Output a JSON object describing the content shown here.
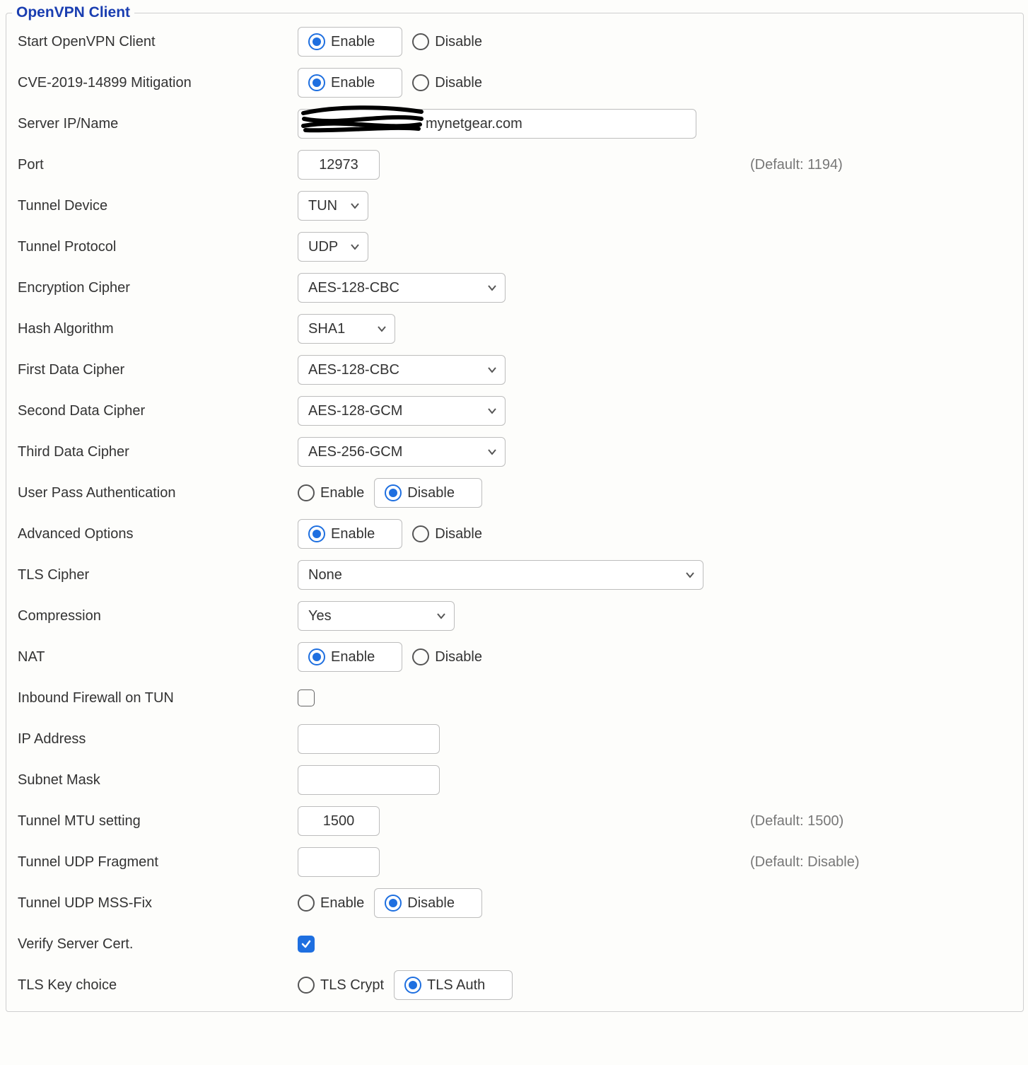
{
  "legend": "OpenVPN Client",
  "labels": {
    "start": "Start OpenVPN Client",
    "cve": "CVE-2019-14899 Mitigation",
    "server": "Server IP/Name",
    "port": "Port",
    "tundev": "Tunnel Device",
    "tunproto": "Tunnel Protocol",
    "encCipher": "Encryption Cipher",
    "hash": "Hash Algorithm",
    "dc1": "First Data Cipher",
    "dc2": "Second Data Cipher",
    "dc3": "Third Data Cipher",
    "upa": "User Pass Authentication",
    "adv": "Advanced Options",
    "tlsCipher": "TLS Cipher",
    "comp": "Compression",
    "nat": "NAT",
    "ifw": "Inbound Firewall on TUN",
    "ip": "IP Address",
    "mask": "Subnet Mask",
    "mtu": "Tunnel MTU setting",
    "frag": "Tunnel UDP Fragment",
    "mss": "Tunnel UDP MSS-Fix",
    "verify": "Verify Server Cert.",
    "tlskey": "TLS Key choice"
  },
  "opt": {
    "enable": "Enable",
    "disable": "Disable",
    "tlsCrypt": "TLS Crypt",
    "tlsAuth": "TLS Auth"
  },
  "values": {
    "server": "mynetgear.com",
    "port": "12973",
    "tundev": "TUN",
    "tunproto": "UDP",
    "encCipher": "AES-128-CBC",
    "hash": "SHA1",
    "dc1": "AES-128-CBC",
    "dc2": "AES-128-GCM",
    "dc3": "AES-256-GCM",
    "tlsCipher": "None",
    "comp": "Yes",
    "ip": "",
    "mask": "",
    "mtu": "1500",
    "frag": ""
  },
  "hints": {
    "port": "(Default: 1194)",
    "mtu": "(Default: 1500)",
    "frag": "(Default: Disable)"
  },
  "radio": {
    "start": "enable",
    "cve": "enable",
    "upa": "disable",
    "adv": "enable",
    "nat": "enable",
    "mss": "disable",
    "tlskey": "auth"
  },
  "check": {
    "ifw": false,
    "verify": true
  }
}
